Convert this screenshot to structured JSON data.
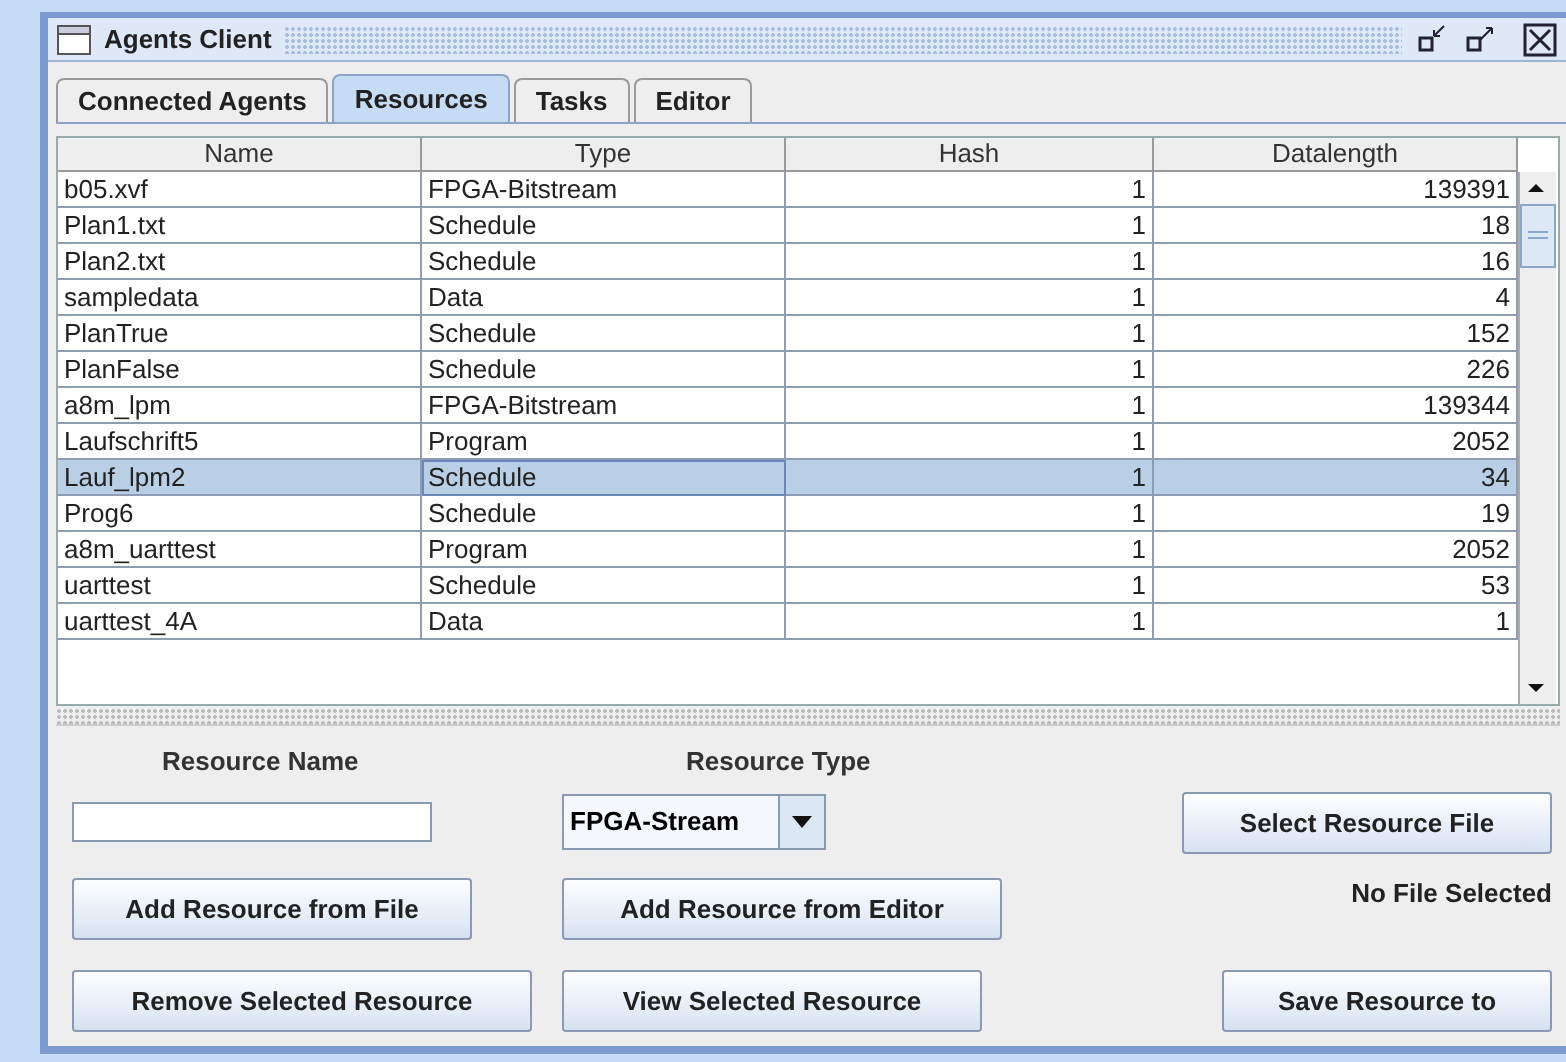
{
  "window": {
    "title": "Agents Client"
  },
  "tabs": [
    {
      "label": "Connected Agents",
      "selected": false
    },
    {
      "label": "Resources",
      "selected": true
    },
    {
      "label": "Tasks",
      "selected": false
    },
    {
      "label": "Editor",
      "selected": false
    }
  ],
  "table": {
    "columns": [
      "Name",
      "Type",
      "Hash",
      "Datalength"
    ],
    "rows": [
      {
        "cells": [
          "b05.xvf",
          "FPGA-Bitstream",
          "1",
          "139391"
        ],
        "selected": false
      },
      {
        "cells": [
          "Plan1.txt",
          "Schedule",
          "1",
          "18"
        ],
        "selected": false
      },
      {
        "cells": [
          "Plan2.txt",
          "Schedule",
          "1",
          "16"
        ],
        "selected": false
      },
      {
        "cells": [
          "sampledata",
          "Data",
          "1",
          "4"
        ],
        "selected": false
      },
      {
        "cells": [
          "PlanTrue",
          "Schedule",
          "1",
          "152"
        ],
        "selected": false
      },
      {
        "cells": [
          "PlanFalse",
          "Schedule",
          "1",
          "226"
        ],
        "selected": false
      },
      {
        "cells": [
          "a8m_lpm",
          "FPGA-Bitstream",
          "1",
          "139344"
        ],
        "selected": false
      },
      {
        "cells": [
          "Laufschrift5",
          "Program",
          "1",
          "2052"
        ],
        "selected": false
      },
      {
        "cells": [
          "Lauf_lpm2",
          "Schedule",
          "1",
          "34"
        ],
        "selected": true
      },
      {
        "cells": [
          "Prog6",
          "Schedule",
          "1",
          "19"
        ],
        "selected": false
      },
      {
        "cells": [
          "a8m_uarttest",
          "Program",
          "1",
          "2052"
        ],
        "selected": false
      },
      {
        "cells": [
          "uarttest",
          "Schedule",
          "1",
          "53"
        ],
        "selected": false
      },
      {
        "cells": [
          "uarttest_4A",
          "Data",
          "1",
          "1"
        ],
        "selected": false
      }
    ]
  },
  "form": {
    "name_label": "Resource Name",
    "type_label": "Resource Type",
    "type_value": "FPGA-Stream",
    "select_file_button": "Select Resource File",
    "add_from_file_button": "Add Resource from File",
    "add_from_editor_button": "Add Resource from Editor",
    "file_status": "No File Selected",
    "remove_button": "Remove Selected Resource",
    "view_button": "View Selected Resource",
    "save_button": "Save Resource to"
  }
}
